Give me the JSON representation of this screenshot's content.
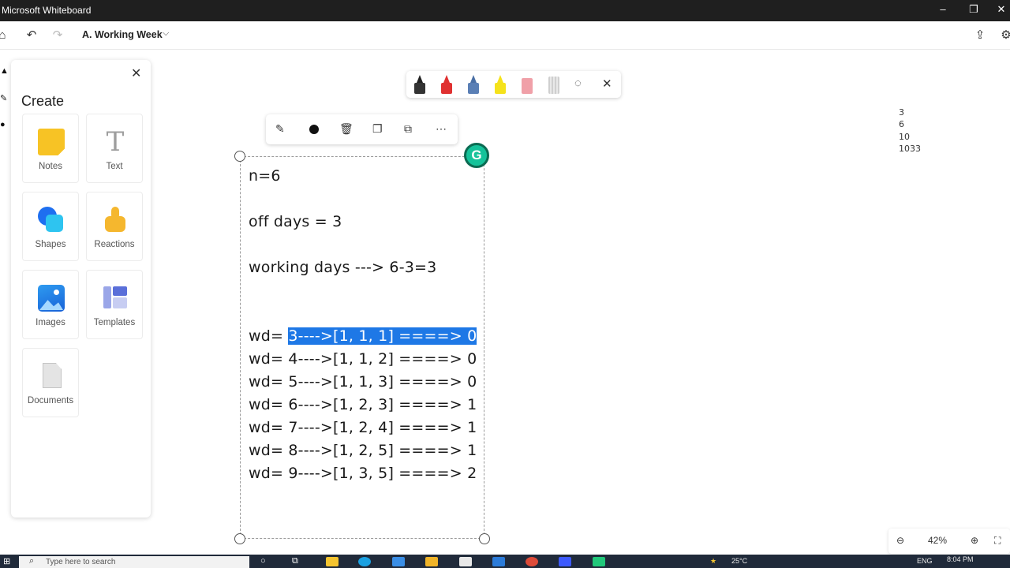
{
  "window": {
    "title": "Microsoft Whiteboard",
    "minimize_icon": "minimize-icon",
    "maximize_icon": "restore-icon",
    "close_icon": "close-icon"
  },
  "header": {
    "doc_title": "A. Working Week",
    "undo_icon": "undo-icon",
    "redo_icon": "redo-icon",
    "share_icon": "share-icon",
    "settings_icon": "gear-icon"
  },
  "create_panel": {
    "title": "Create",
    "items": [
      {
        "label": "Notes",
        "icon": "sticky-note-icon",
        "color": "#f7c325"
      },
      {
        "label": "Text",
        "icon": "text-icon",
        "color": "#9e9e9e"
      },
      {
        "label": "Shapes",
        "icon": "shapes-icon",
        "color": "#1e6ff0"
      },
      {
        "label": "Reactions",
        "icon": "thumbs-up-icon",
        "color": "#f5b72e"
      },
      {
        "label": "Images",
        "icon": "image-icon",
        "color": "#1e88e5"
      },
      {
        "label": "Templates",
        "icon": "templates-icon",
        "color": "#6b7cdb"
      },
      {
        "label": "Documents",
        "icon": "document-icon",
        "color": "#bdbdbd"
      }
    ]
  },
  "pen_toolbar": {
    "pens": [
      {
        "name": "black-pen",
        "color": "#222222"
      },
      {
        "name": "red-pen",
        "color": "#e03131"
      },
      {
        "name": "blue-pen",
        "color": "#4a6fa5"
      },
      {
        "name": "yellow-highlighter",
        "color": "#f5e21b"
      },
      {
        "name": "pink-eraser",
        "color": "#f0a0a8"
      },
      {
        "name": "ruler",
        "color": "#cfcfcf"
      }
    ]
  },
  "ink": {
    "lines": [
      "n=6",
      "off days = 3",
      "working days ---> 6-3=3"
    ],
    "wd_prefix": "wd= ",
    "wd_rows": [
      "3---->[1, 1, 1] ====> 0",
      "4---->[1, 1, 2] ====> 0",
      "5---->[1, 1, 3] ====> 0",
      "6---->[1, 2, 3] ====> 1",
      "7---->[1, 2, 4] ====> 1",
      "8---->[1, 2, 5] ====> 1",
      "9---->[1, 3, 5] ====> 2"
    ]
  },
  "side_numbers": [
    "3",
    "6",
    "10",
    "1033"
  ],
  "zoom": {
    "value": "42%"
  },
  "taskbar": {
    "search_placeholder": "Type here to search",
    "weather": "25°C",
    "language": "ENG",
    "time": "8:04 PM"
  }
}
